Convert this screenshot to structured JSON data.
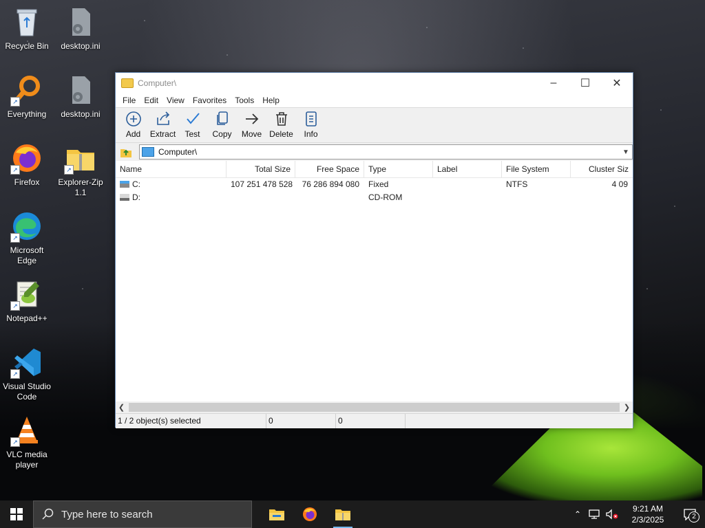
{
  "desktop": {
    "icons": [
      {
        "label": "Recycle Bin"
      },
      {
        "label": "desktop.ini"
      },
      {
        "label": "Everything"
      },
      {
        "label": "desktop.ini"
      },
      {
        "label": "Firefox"
      },
      {
        "label": "Explorer-Zip 1.1"
      },
      {
        "label": "Microsoft Edge"
      },
      {
        "label": "Notepad++"
      },
      {
        "label": "Visual Studio Code"
      },
      {
        "label": "VLC media player"
      }
    ]
  },
  "window": {
    "title": "Computer\\",
    "menu": [
      "File",
      "Edit",
      "View",
      "Favorites",
      "Tools",
      "Help"
    ],
    "toolbar": [
      {
        "label": "Add",
        "icon": "add-icon"
      },
      {
        "label": "Extract",
        "icon": "extract-icon"
      },
      {
        "label": "Test",
        "icon": "check-icon"
      },
      {
        "label": "Copy",
        "icon": "copy-icon"
      },
      {
        "label": "Move",
        "icon": "arrow-right-icon"
      },
      {
        "label": "Delete",
        "icon": "trash-icon"
      },
      {
        "label": "Info",
        "icon": "info-icon"
      }
    ],
    "address": "Computer\\",
    "columns": [
      "Name",
      "Total Size",
      "Free Space",
      "Type",
      "Label",
      "File System",
      "Cluster Siz"
    ],
    "rows": [
      {
        "name": "C:",
        "total": "107 251 478 528",
        "free": "76 286 894 080",
        "type": "Fixed",
        "label": "",
        "fs": "NTFS",
        "cluster": "4 09"
      },
      {
        "name": "D:",
        "total": "",
        "free": "",
        "type": "CD-ROM",
        "label": "",
        "fs": "",
        "cluster": ""
      }
    ],
    "status": {
      "selected": "1 / 2 object(s) selected",
      "size1": "0",
      "size2": "0"
    }
  },
  "taskbar": {
    "search_placeholder": "Type here to search",
    "time": "9:21 AM",
    "date": "2/3/2025",
    "notifications": "2",
    "accent": "#76b9ed"
  }
}
